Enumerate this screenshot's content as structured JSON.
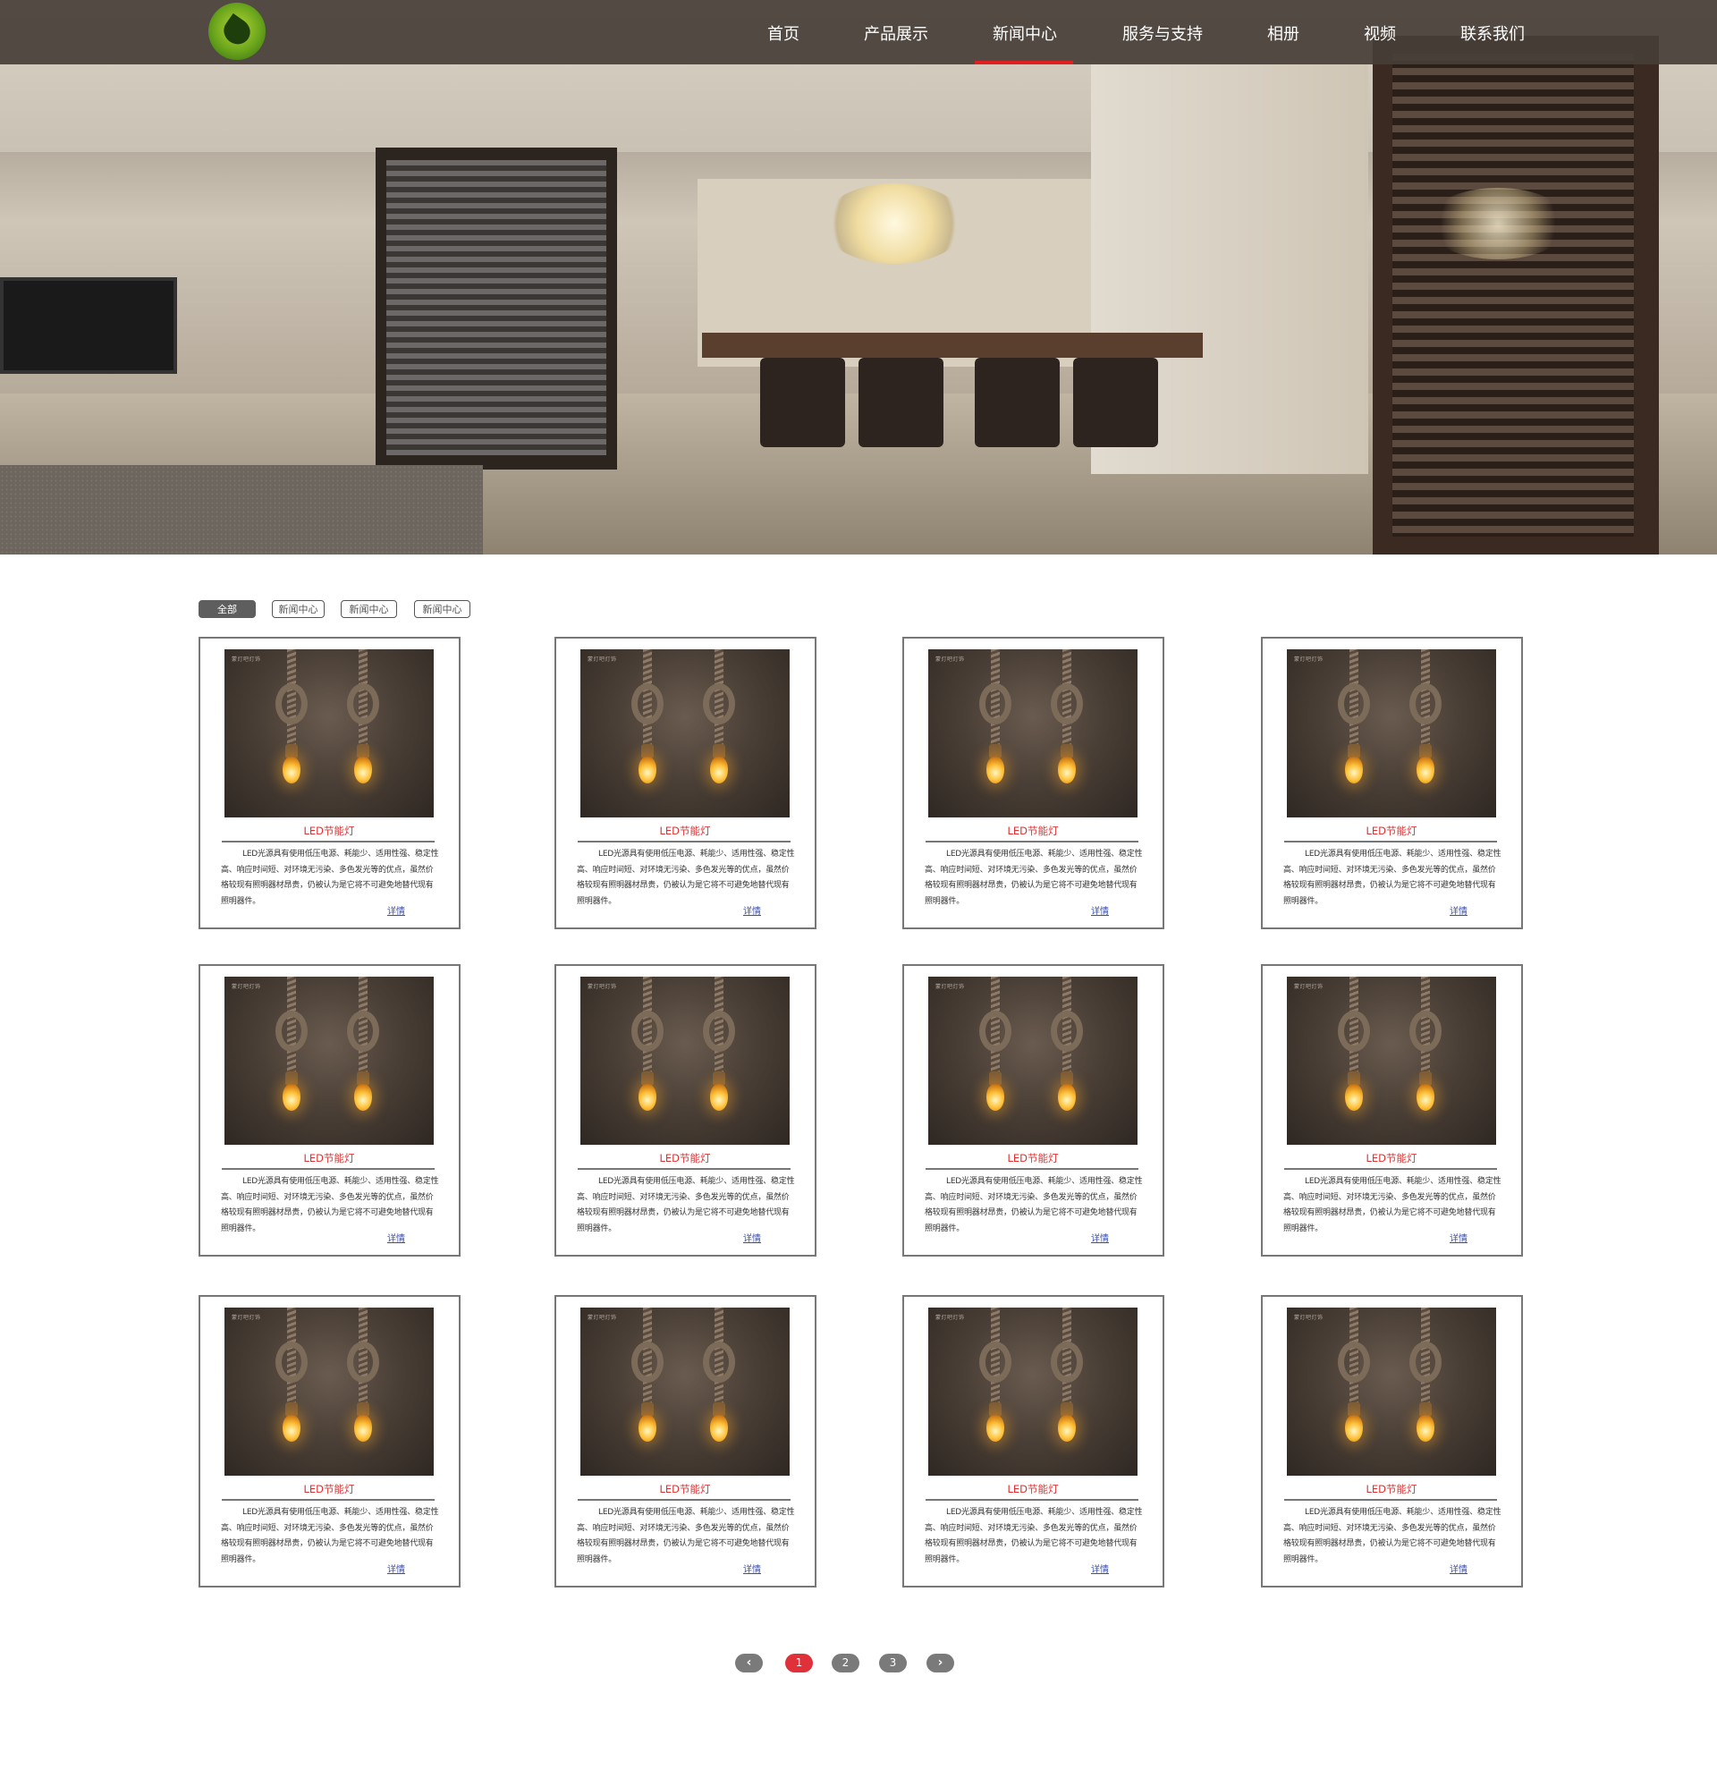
{
  "nav": {
    "items": [
      {
        "label": "首页"
      },
      {
        "label": "产品展示"
      },
      {
        "label": "新闻中心",
        "active": true
      },
      {
        "label": "服务与支持"
      },
      {
        "label": "相册"
      },
      {
        "label": "视频"
      },
      {
        "label": "联系我们"
      }
    ],
    "active_color": "#e02020"
  },
  "filters": [
    {
      "label": "全部",
      "active": true
    },
    {
      "label": "新闻中心"
    },
    {
      "label": "新闻中心"
    },
    {
      "label": "新闻中心"
    }
  ],
  "cards": [
    {
      "title": "LED节能灯",
      "brand": "蒙灯吧灯饰",
      "desc": "LED光源具有使用低压电源、耗能少、适用性强、稳定性高、响应时间短、对环境无污染、多色发光等的优点，虽然价格较现有照明器材昂贵，仍被认为是它将不可避免地替代现有照明器件。",
      "more": "详情"
    },
    {
      "title": "LED节能灯",
      "brand": "蒙灯吧灯饰",
      "desc": "LED光源具有使用低压电源、耗能少、适用性强、稳定性高、响应时间短、对环境无污染、多色发光等的优点，虽然价格较现有照明器材昂贵，仍被认为是它将不可避免地替代现有照明器件。",
      "more": "详情"
    },
    {
      "title": "LED节能灯",
      "brand": "蒙灯吧灯饰",
      "desc": "LED光源具有使用低压电源、耗能少、适用性强、稳定性高、响应时间短、对环境无污染、多色发光等的优点，虽然价格较现有照明器材昂贵，仍被认为是它将不可避免地替代现有照明器件。",
      "more": "详情"
    },
    {
      "title": "LED节能灯",
      "brand": "蒙灯吧灯饰",
      "desc": "LED光源具有使用低压电源、耗能少、适用性强、稳定性高、响应时间短、对环境无污染、多色发光等的优点，虽然价格较现有照明器材昂贵，仍被认为是它将不可避免地替代现有照明器件。",
      "more": "详情"
    },
    {
      "title": "LED节能灯",
      "brand": "蒙灯吧灯饰",
      "desc": "LED光源具有使用低压电源、耗能少、适用性强、稳定性高、响应时间短、对环境无污染、多色发光等的优点，虽然价格较现有照明器材昂贵，仍被认为是它将不可避免地替代现有照明器件。",
      "more": "详情"
    },
    {
      "title": "LED节能灯",
      "brand": "蒙灯吧灯饰",
      "desc": "LED光源具有使用低压电源、耗能少、适用性强、稳定性高、响应时间短、对环境无污染、多色发光等的优点，虽然价格较现有照明器材昂贵，仍被认为是它将不可避免地替代现有照明器件。",
      "more": "详情"
    },
    {
      "title": "LED节能灯",
      "brand": "蒙灯吧灯饰",
      "desc": "LED光源具有使用低压电源、耗能少、适用性强、稳定性高、响应时间短、对环境无污染、多色发光等的优点，虽然价格较现有照明器材昂贵，仍被认为是它将不可避免地替代现有照明器件。",
      "more": "详情"
    },
    {
      "title": "LED节能灯",
      "brand": "蒙灯吧灯饰",
      "desc": "LED光源具有使用低压电源、耗能少、适用性强、稳定性高、响应时间短、对环境无污染、多色发光等的优点，虽然价格较现有照明器材昂贵，仍被认为是它将不可避免地替代现有照明器件。",
      "more": "详情"
    },
    {
      "title": "LED节能灯",
      "brand": "蒙灯吧灯饰",
      "desc": "LED光源具有使用低压电源、耗能少、适用性强、稳定性高、响应时间短、对环境无污染、多色发光等的优点，虽然价格较现有照明器材昂贵，仍被认为是它将不可避免地替代现有照明器件。",
      "more": "详情"
    },
    {
      "title": "LED节能灯",
      "brand": "蒙灯吧灯饰",
      "desc": "LED光源具有使用低压电源、耗能少、适用性强、稳定性高、响应时间短、对环境无污染、多色发光等的优点，虽然价格较现有照明器材昂贵，仍被认为是它将不可避免地替代现有照明器件。",
      "more": "详情"
    },
    {
      "title": "LED节能灯",
      "brand": "蒙灯吧灯饰",
      "desc": "LED光源具有使用低压电源、耗能少、适用性强、稳定性高、响应时间短、对环境无污染、多色发光等的优点，虽然价格较现有照明器材昂贵，仍被认为是它将不可避免地替代现有照明器件。",
      "more": "详情"
    },
    {
      "title": "LED节能灯",
      "brand": "蒙灯吧灯饰",
      "desc": "LED光源具有使用低压电源、耗能少、适用性强、稳定性高、响应时间短、对环境无污染、多色发光等的优点，虽然价格较现有照明器材昂贵，仍被认为是它将不可避免地替代现有照明器件。",
      "more": "详情"
    }
  ],
  "pagination": {
    "prev_icon": "chevron-left-icon",
    "next_icon": "chevron-right-icon",
    "pages": [
      "1",
      "2",
      "3"
    ],
    "current": "1"
  }
}
